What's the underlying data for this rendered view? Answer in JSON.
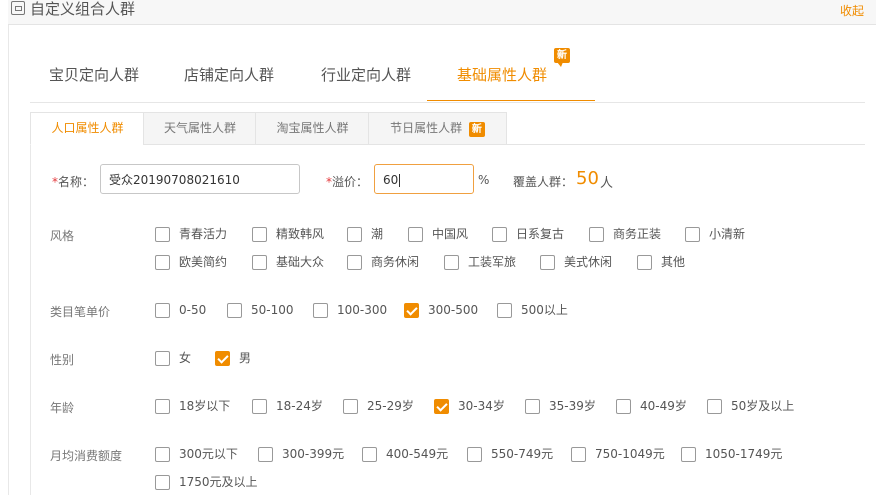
{
  "header": {
    "title": "自定义组合人群",
    "collapse_label": "收起"
  },
  "main_tabs": [
    {
      "label": "宝贝定向人群"
    },
    {
      "label": "店铺定向人群"
    },
    {
      "label": "行业定向人群"
    },
    {
      "label": "基础属性人群",
      "badge": "新",
      "active": true
    }
  ],
  "sub_tabs": [
    {
      "label": "人口属性人群",
      "active": true
    },
    {
      "label": "天气属性人群"
    },
    {
      "label": "淘宝属性人群"
    },
    {
      "label": "节日属性人群",
      "badge": "新"
    }
  ],
  "form": {
    "name_required": "*",
    "name_label": "名称：",
    "name_value": "受众20190708021610",
    "premium_required": "*",
    "premium_label": "溢价：",
    "premium_value": "60",
    "premium_unit": "%",
    "cover_label": "覆盖人群：",
    "cover_value": "50",
    "cover_unit": "人"
  },
  "style_group": {
    "label": "风格",
    "options": [
      {
        "label": "青春活力",
        "checked": false
      },
      {
        "label": "精致韩风",
        "checked": false
      },
      {
        "label": "潮",
        "checked": false
      },
      {
        "label": "中国风",
        "checked": false
      },
      {
        "label": "日系复古",
        "checked": false
      },
      {
        "label": "商务正装",
        "checked": false
      },
      {
        "label": "小清新",
        "checked": false
      },
      {
        "label": "欧美简约",
        "checked": false
      },
      {
        "label": "基础大众",
        "checked": false
      },
      {
        "label": "商务休闲",
        "checked": false
      },
      {
        "label": "工装军旅",
        "checked": false
      },
      {
        "label": "美式休闲",
        "checked": false
      },
      {
        "label": "其他",
        "checked": false
      }
    ]
  },
  "price_group": {
    "label": "类目笔单价",
    "options": [
      {
        "label": "0-50",
        "checked": false
      },
      {
        "label": "50-100",
        "checked": false
      },
      {
        "label": "100-300",
        "checked": false
      },
      {
        "label": "300-500",
        "checked": true
      },
      {
        "label": "500以上",
        "checked": false
      }
    ]
  },
  "gender_group": {
    "label": "性别",
    "options": [
      {
        "label": "女",
        "checked": false
      },
      {
        "label": "男",
        "checked": true
      }
    ]
  },
  "age_group": {
    "label": "年龄",
    "options": [
      {
        "label": "18岁以下",
        "checked": false
      },
      {
        "label": "18-24岁",
        "checked": false
      },
      {
        "label": "25-29岁",
        "checked": false
      },
      {
        "label": "30-34岁",
        "checked": true
      },
      {
        "label": "35-39岁",
        "checked": false
      },
      {
        "label": "40-49岁",
        "checked": false
      },
      {
        "label": "50岁及以上",
        "checked": false
      }
    ]
  },
  "spend_group": {
    "label": "月均消费额度",
    "options": [
      {
        "label": "300元以下",
        "checked": false
      },
      {
        "label": "300-399元",
        "checked": false
      },
      {
        "label": "400-549元",
        "checked": false
      },
      {
        "label": "550-749元",
        "checked": false
      },
      {
        "label": "750-1049元",
        "checked": false
      },
      {
        "label": "1050-1749元",
        "checked": false
      },
      {
        "label": "1750元及以上",
        "checked": false
      }
    ]
  },
  "colors": {
    "accent": "#f08c00",
    "required": "#e4393c",
    "border": "#c7c7c7"
  }
}
